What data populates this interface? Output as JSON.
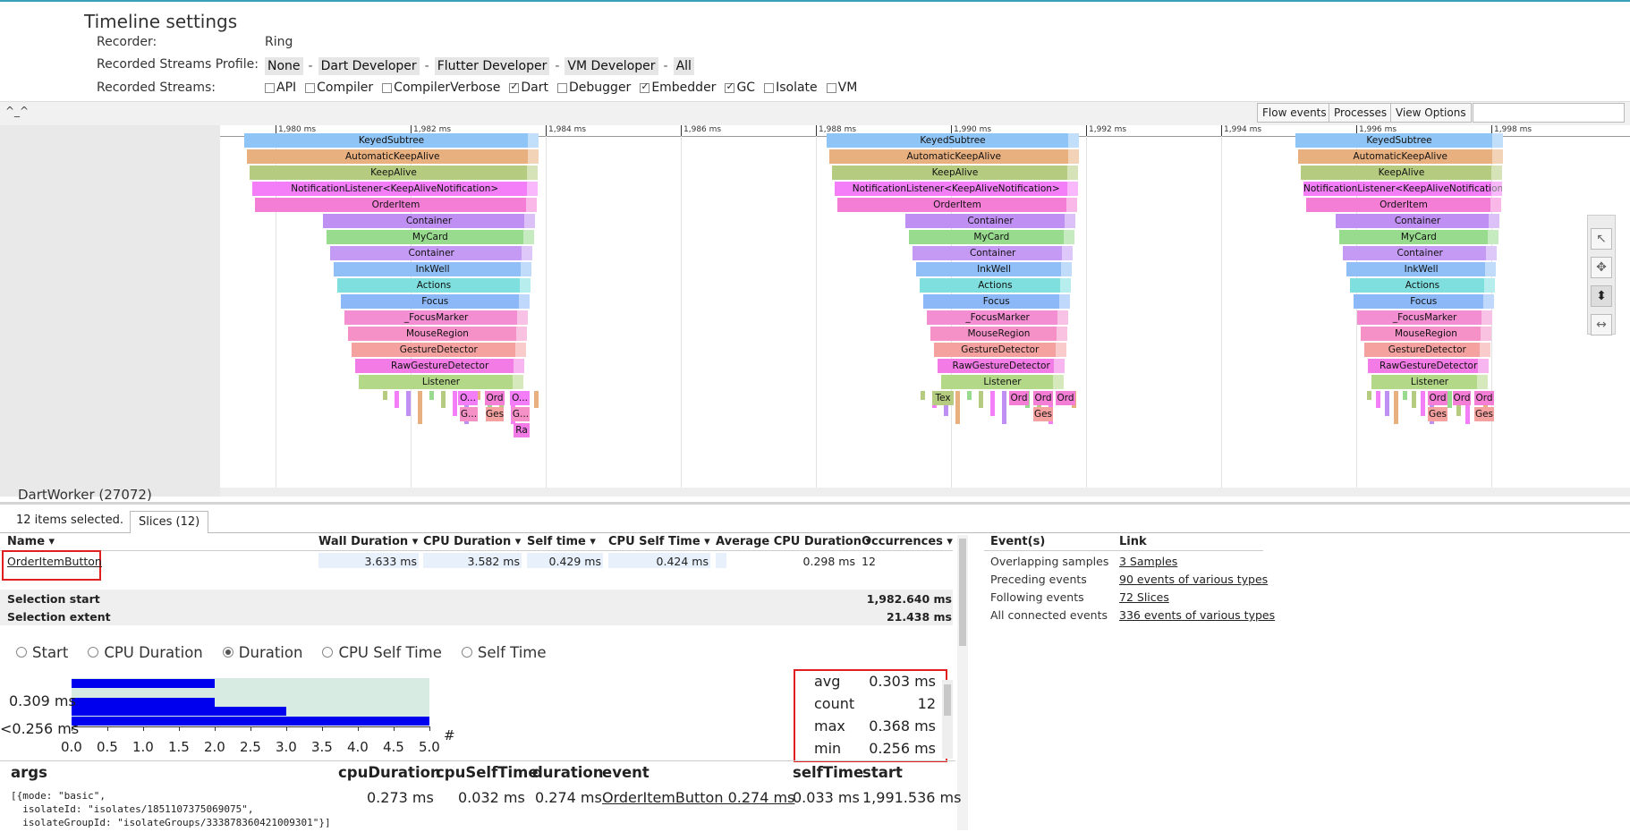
{
  "settings": {
    "title": "Timeline settings",
    "recorder_label": "Recorder:",
    "recorder_value": "Ring",
    "profile_label": "Recorded Streams Profile:",
    "profiles": [
      "None",
      "Dart Developer",
      "Flutter Developer",
      "VM Developer",
      "All"
    ],
    "profile_sep": "-",
    "streams_label": "Recorded Streams:",
    "streams": [
      {
        "name": "API",
        "checked": false
      },
      {
        "name": "Compiler",
        "checked": false
      },
      {
        "name": "CompilerVerbose",
        "checked": false
      },
      {
        "name": "Dart",
        "checked": true
      },
      {
        "name": "Debugger",
        "checked": false
      },
      {
        "name": "Embedder",
        "checked": true
      },
      {
        "name": "GC",
        "checked": true
      },
      {
        "name": "Isolate",
        "checked": false
      },
      {
        "name": "VM",
        "checked": false
      }
    ]
  },
  "toolbar": {
    "handle": "^_^",
    "flow_events": "Flow events",
    "processes": "Processes",
    "view_options": "View Options"
  },
  "track": {
    "label": "DartWorker (27072)",
    "ruler_ticks": [
      "1,980 ms",
      "1,982 ms",
      "1,984 ms",
      "1,986 ms",
      "1,988 ms",
      "1,990 ms",
      "1,992 ms",
      "1,994 ms",
      "1,996 ms",
      "1,998 ms"
    ],
    "flame_rows": [
      "KeyedSubtree",
      "AutomaticKeepAlive",
      "KeepAlive",
      "NotificationListener<KeepAliveNotification>",
      "OrderItem",
      "Container",
      "MyCard",
      "Container",
      "InkWell",
      "Actions",
      "Focus",
      "_FocusMarker",
      "MouseRegion",
      "GestureDetector",
      "RawGestureDetector",
      "Listener"
    ],
    "row_colors": [
      "#8ec4f6",
      "#e9b07f",
      "#b5cc80",
      "#f37ef7",
      "#f47ed6",
      "#c08ff3",
      "#98db8e",
      "#c49af4",
      "#8fbff6",
      "#7fdede",
      "#8db8f7",
      "#f38ed2",
      "#f691c8",
      "#f4a1a0",
      "#f27be6",
      "#b3d888"
    ],
    "small_labels_1": [
      "O...",
      "Ord",
      "O...",
      "G...",
      "Ges",
      "G...",
      "Ra"
    ],
    "small_labels_2": [
      "Tex",
      "Ord",
      "Ord",
      "Ord",
      "Ges"
    ],
    "small_labels_3": [
      "Ord",
      "Ord",
      "Ord",
      "Ges",
      "Ges"
    ]
  },
  "selection": {
    "count_text": "12 items selected.",
    "tab_label": "Slices (12)"
  },
  "table": {
    "headers": [
      "Name",
      "Wall Duration",
      "CPU Duration",
      "Self time",
      "CPU Self Time",
      "Average CPU Duration",
      "Occurrences"
    ],
    "row": {
      "name": "OrderItemButton",
      "wall": "3.633 ms",
      "cpu": "3.582 ms",
      "self": "0.429 ms",
      "cpu_self": "0.424 ms",
      "avg_cpu": "0.298 ms",
      "occurrences": "12"
    },
    "selection_start_label": "Selection start",
    "selection_start": "1,982.640 ms",
    "selection_extent_label": "Selection extent",
    "selection_extent": "21.438 ms"
  },
  "radios": [
    {
      "label": "Start",
      "checked": false
    },
    {
      "label": "CPU Duration",
      "checked": false
    },
    {
      "label": "Duration",
      "checked": true
    },
    {
      "label": "CPU Self Time",
      "checked": false
    },
    {
      "label": "Self Time",
      "checked": false
    }
  ],
  "histogram": {
    "y_labels": [
      "0.309 ms",
      "<0.256 ms"
    ],
    "bar_counts": [
      2,
      2,
      3,
      5
    ],
    "x_ticks": [
      "0.0",
      "0.5",
      "1.0",
      "1.5",
      "2.0",
      "2.5",
      "3.0",
      "3.5",
      "4.0",
      "4.5",
      "5.0"
    ],
    "x_unit": "#",
    "colors": {
      "bar": "#0000ee",
      "bg": "#d7ebe3"
    }
  },
  "stats": [
    {
      "label": "avg",
      "value": "0.303 ms"
    },
    {
      "label": "count",
      "value": "12"
    },
    {
      "label": "max",
      "value": "0.368 ms"
    },
    {
      "label": "min",
      "value": "0.256 ms"
    }
  ],
  "args_table": {
    "headers": {
      "args": "args",
      "cpuDuration": "cpuDuration",
      "cpuSelfTime": "cpuSelfTime",
      "duration": "duration",
      "event": "event",
      "selfTime": "selfTime",
      "start": "start"
    },
    "row": {
      "args_line1": "[{mode: \"basic\",",
      "args_line2": "  isolateId: \"isolates/1851107375069075\",",
      "args_line3": "  isolateGroupId: \"isolateGroups/333878360421009301\"}]",
      "cpuDuration": "0.273 ms",
      "cpuSelfTime": "0.032 ms",
      "duration": "0.274 ms",
      "event": "OrderItemButton 0.274 ms",
      "selfTime": "0.033 ms",
      "start": "1,991.536 ms"
    }
  },
  "events": {
    "head_events": "Event(s)",
    "head_link": "Link",
    "rows": [
      {
        "label": "Overlapping samples",
        "link": "3 Samples"
      },
      {
        "label": "Preceding events",
        "link": "90 events of various types"
      },
      {
        "label": "Following events",
        "link": "72 Slices"
      },
      {
        "label": "All connected events",
        "link": "336 events of various types"
      }
    ]
  }
}
